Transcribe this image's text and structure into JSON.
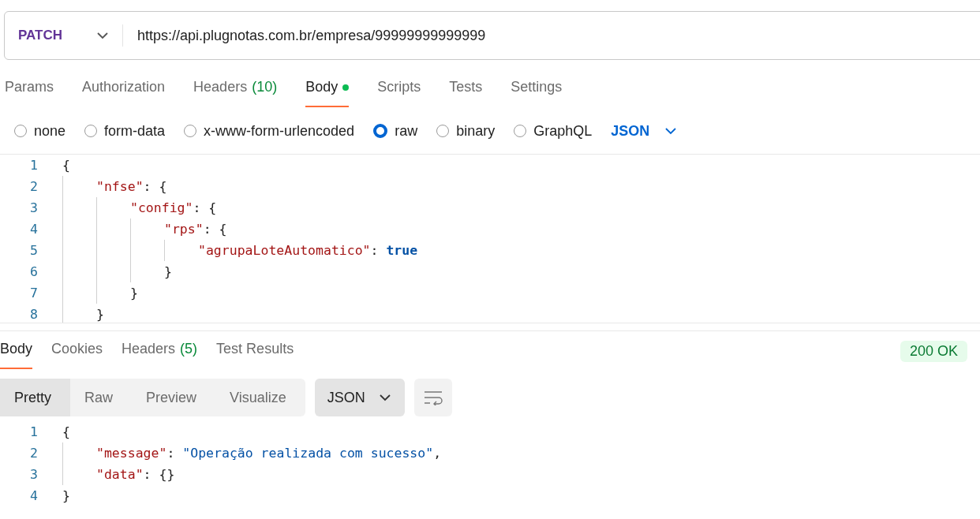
{
  "request": {
    "method": "PATCH",
    "url": "https://api.plugnotas.com.br/empresa/99999999999999"
  },
  "request_tabs": [
    {
      "label": "Params",
      "selected": false
    },
    {
      "label": "Authorization",
      "selected": false
    },
    {
      "label": "Headers",
      "count": "(10)",
      "selected": false
    },
    {
      "label": "Body",
      "selected": true,
      "modified": true
    },
    {
      "label": "Scripts",
      "selected": false
    },
    {
      "label": "Tests",
      "selected": false
    },
    {
      "label": "Settings",
      "selected": false
    }
  ],
  "body_types": [
    {
      "label": "none",
      "selected": false
    },
    {
      "label": "form-data",
      "selected": false
    },
    {
      "label": "x-www-form-urlencoded",
      "selected": false
    },
    {
      "label": "raw",
      "selected": true
    },
    {
      "label": "binary",
      "selected": false
    },
    {
      "label": "GraphQL",
      "selected": false
    }
  ],
  "body_format": "JSON",
  "request_body": [
    {
      "number": "1",
      "tokens": [
        {
          "kind": "punct",
          "text": "{"
        }
      ],
      "children": [
        {
          "number": "2",
          "tokens": [
            {
              "kind": "key",
              "text": "\"nfse\""
            },
            {
              "kind": "punct",
              "text": ": {"
            }
          ],
          "children": [
            {
              "number": "3",
              "tokens": [
                {
                  "kind": "key",
                  "text": "\"config\""
                },
                {
                  "kind": "punct",
                  "text": ": {"
                }
              ],
              "children": [
                {
                  "number": "4",
                  "tokens": [
                    {
                      "kind": "key",
                      "text": "\"rps\""
                    },
                    {
                      "kind": "punct",
                      "text": ": {"
                    }
                  ],
                  "children": [
                    {
                      "number": "5",
                      "tokens": [
                        {
                          "kind": "key",
                          "text": "\"agrupaLoteAutomatico\""
                        },
                        {
                          "kind": "punct",
                          "text": ": "
                        },
                        {
                          "kind": "bool",
                          "text": "true"
                        }
                      ]
                    }
                  ]
                },
                {
                  "number": "6",
                  "tokens": [
                    {
                      "kind": "punct",
                      "text": "}"
                    }
                  ]
                }
              ]
            },
            {
              "number": "7",
              "tokens": [
                {
                  "kind": "punct",
                  "text": "}"
                }
              ]
            }
          ]
        },
        {
          "number": "8",
          "tokens": [
            {
              "kind": "punct",
              "text": "}"
            }
          ]
        }
      ]
    }
  ],
  "response_tabs": [
    {
      "label": "Body",
      "selected": true
    },
    {
      "label": "Cookies",
      "selected": false
    },
    {
      "label": "Headers",
      "count": "(5)",
      "selected": false
    },
    {
      "label": "Test Results",
      "selected": false
    }
  ],
  "status": "200 OK",
  "view_modes": [
    {
      "label": "Pretty",
      "selected": true
    },
    {
      "label": "Raw",
      "selected": false
    },
    {
      "label": "Preview",
      "selected": false
    },
    {
      "label": "Visualize",
      "selected": false
    }
  ],
  "response_format": "JSON",
  "response_body": [
    {
      "number": "1",
      "tokens": [
        {
          "kind": "punct",
          "text": "{"
        }
      ],
      "children": [
        {
          "number": "2",
          "tokens": [
            {
              "kind": "key",
              "text": "\"message\""
            },
            {
              "kind": "punct",
              "text": ": "
            },
            {
              "kind": "string",
              "text": "\"Operação realizada com sucesso\""
            },
            {
              "kind": "punct",
              "text": ","
            }
          ]
        },
        {
          "number": "3",
          "tokens": [
            {
              "kind": "key",
              "text": "\"data\""
            },
            {
              "kind": "punct",
              "text": ": {}"
            }
          ]
        }
      ]
    },
    {
      "number": "4",
      "tokens": [
        {
          "kind": "punct",
          "text": "}"
        }
      ]
    }
  ]
}
